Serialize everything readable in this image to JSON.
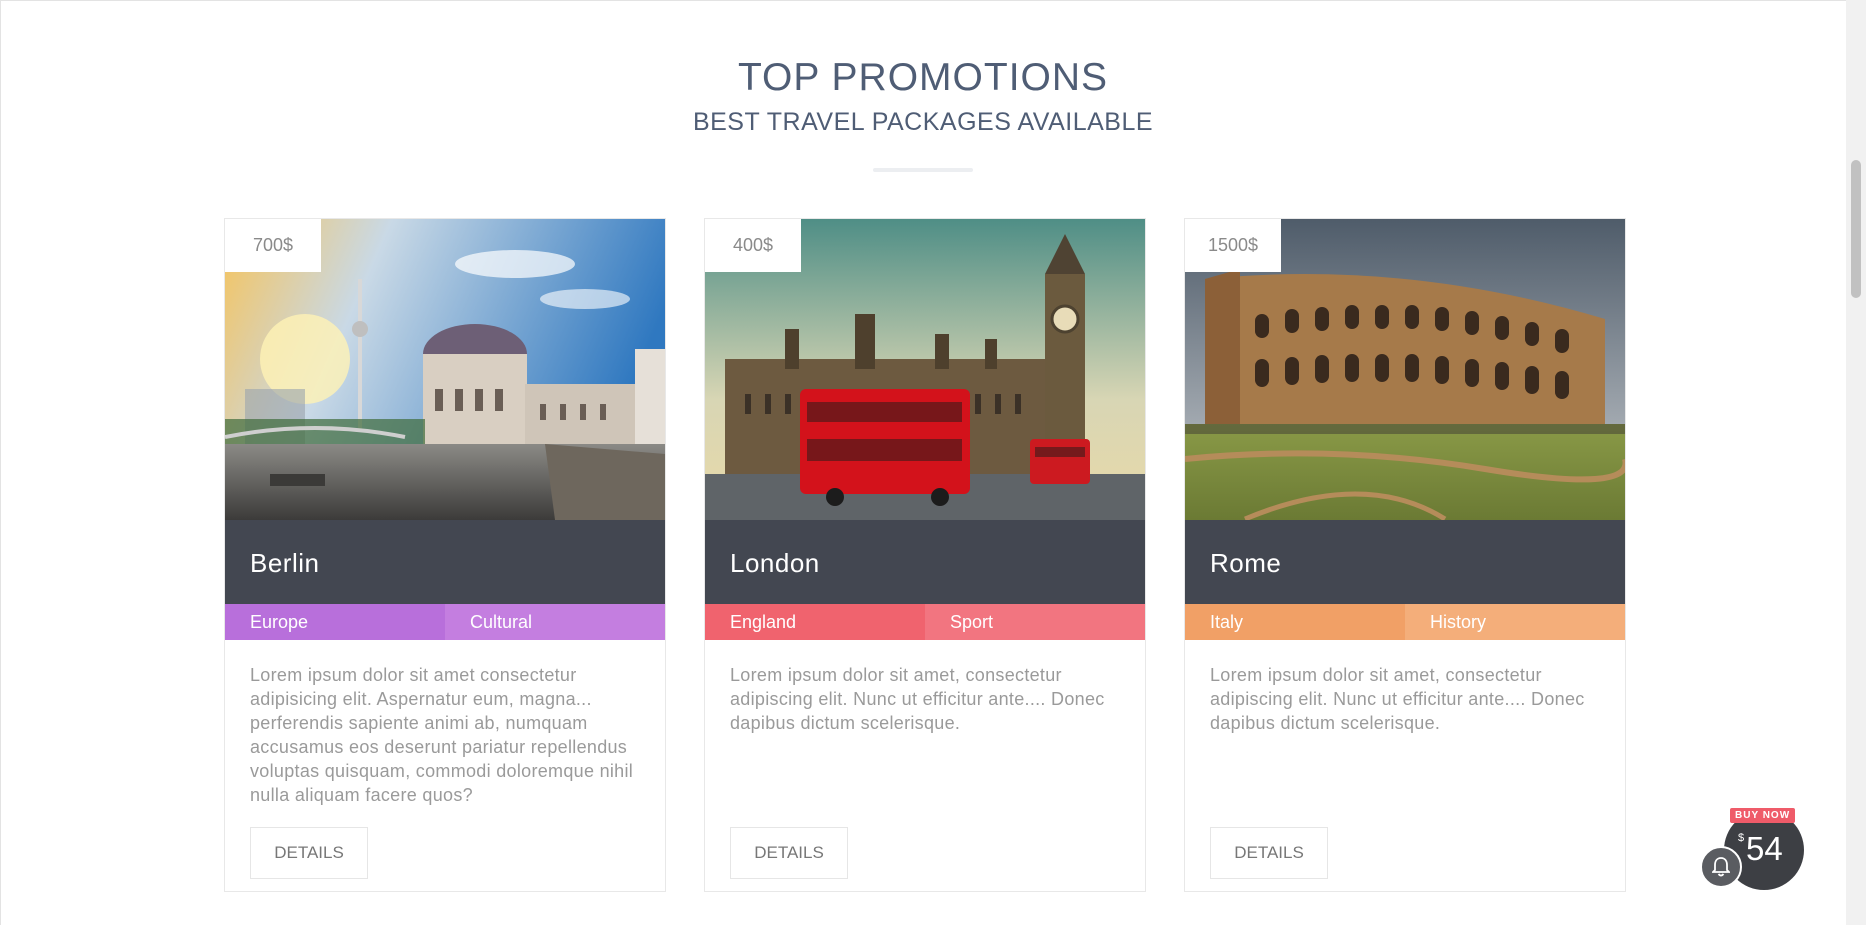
{
  "header": {
    "title": "TOP PROMOTIONS",
    "subtitle": "BEST TRAVEL PACKAGES AVAILABLE"
  },
  "cards": [
    {
      "price": "700$",
      "title": "Berlin",
      "tags": [
        "Europe",
        "Cultural"
      ],
      "description": "Lorem ipsum dolor sit amet consectetur adipisicing elit. Aspernatur eum, magna... perferendis sapiente animi ab, numquam accusamus eos deserunt pariatur repellendus voluptas quisquam, commodi doloremque nihil nulla aliquam facere quos?",
      "button": "DETAILS",
      "tag_colors": [
        "#b86fdb",
        "#c47ee0"
      ]
    },
    {
      "price": "400$",
      "title": "London",
      "tags": [
        "England",
        "Sport"
      ],
      "description": "Lorem ipsum dolor sit amet, consectetur adipiscing elit. Nunc ut efficitur ante.... Donec dapibus dictum scelerisque.",
      "button": "DETAILS",
      "tag_colors": [
        "#f0636e",
        "#f27580"
      ]
    },
    {
      "price": "1500$",
      "title": "Rome",
      "tags": [
        "Italy",
        "History"
      ],
      "description": "Lorem ipsum dolor sit amet, consectetur adipiscing elit. Nunc ut efficitur ante.... Donec dapibus dictum scelerisque.",
      "button": "DETAILS",
      "tag_colors": [
        "#f1a066",
        "#f4ae7a"
      ]
    }
  ],
  "buy_widget": {
    "badge": "BUY NOW",
    "currency": "$",
    "price": "54",
    "icon": "bell-icon"
  },
  "colors": {
    "heading": "#4f5d75",
    "card_title_bar": "#434751"
  }
}
